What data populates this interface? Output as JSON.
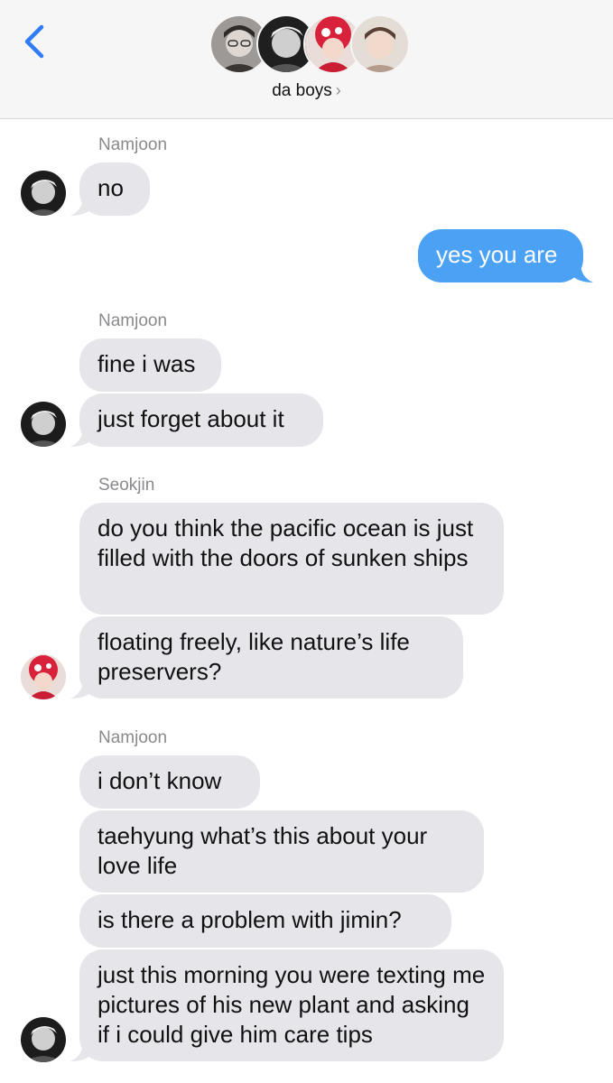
{
  "header": {
    "group_name": "da boys",
    "chevron": "›",
    "back_icon": "chevron-left-icon",
    "accent": "#2f7cf6"
  },
  "colors": {
    "incoming_bubble": "#e5e5ea",
    "outgoing_bubble": "#4ba1f3"
  },
  "messages": [
    {
      "sender_label": "Namjoon",
      "text": "no"
    },
    {
      "text": "yes you are"
    },
    {
      "sender_label": "Namjoon",
      "text": "fine i was"
    },
    {
      "text": "just forget about it"
    },
    {
      "sender_label": "Seokjin",
      "text": "do you think the pacific ocean is just filled with the doors of sunken ships"
    },
    {
      "text": "floating freely, like nature’s life preservers?"
    },
    {
      "sender_label": "Namjoon",
      "text": "i don’t know"
    },
    {
      "text": "taehyung what’s this about your love life"
    },
    {
      "text": "is there a problem with jimin?"
    },
    {
      "text": "just this morning you were texting me pictures of his new plant and asking if i could give him care tips"
    }
  ]
}
